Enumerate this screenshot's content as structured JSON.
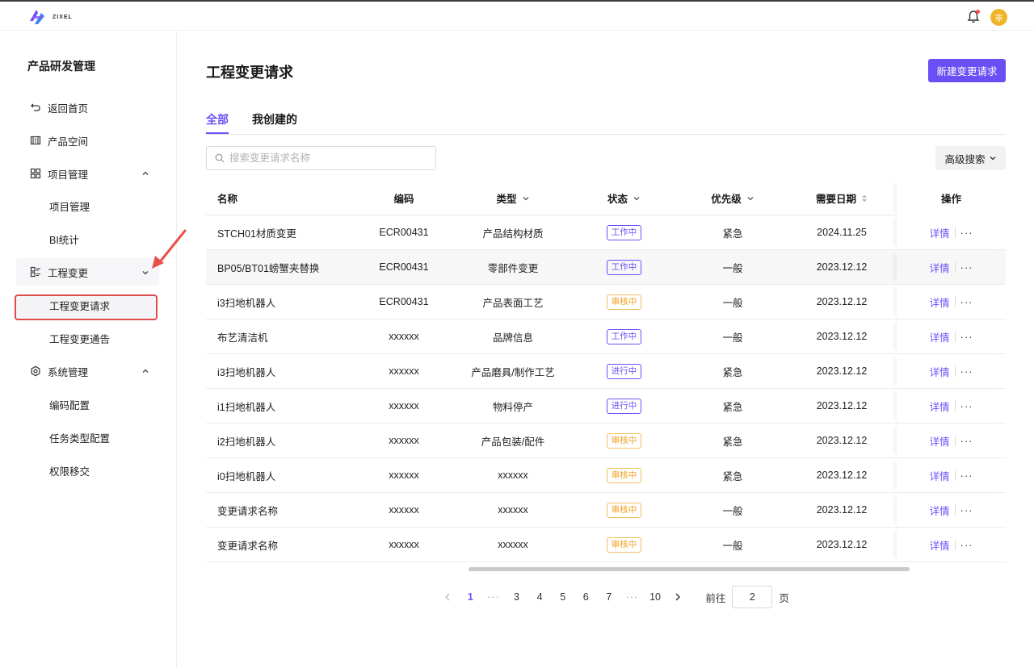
{
  "app": {
    "logo_text": "ZIXEL",
    "avatar_text": "非"
  },
  "sidebar": {
    "title": "产品研发管理",
    "items": [
      {
        "label": "返回首页",
        "icon": "back-arrow-icon"
      },
      {
        "label": "产品空间",
        "icon": "product-space-icon"
      },
      {
        "label": "项目管理",
        "icon": "grid-icon",
        "expanded": true,
        "children": [
          "项目管理",
          "BI统计"
        ]
      },
      {
        "label": "工程变更",
        "icon": "list-icon",
        "expanded": true,
        "children": [
          "工程变更请求",
          "工程变更通告"
        ]
      },
      {
        "label": "系统管理",
        "icon": "gear-icon",
        "expanded": true,
        "children": [
          "编码配置",
          "任务类型配置",
          "权限移交"
        ]
      }
    ],
    "selected": "工程变更请求"
  },
  "main": {
    "title": "工程变更请求",
    "new_button": "新建变更请求",
    "tabs": [
      "全部",
      "我创建的"
    ],
    "active_tab": "全部",
    "search_placeholder": "搜索变更请求名称",
    "advanced_search": "高级搜索"
  },
  "table": {
    "columns": [
      "名称",
      "编码",
      "类型",
      "状态",
      "优先级",
      "需要日期",
      "操作"
    ],
    "rows": [
      {
        "name": "STCH01材质变更",
        "code": "ECR00431",
        "type": "产品结构材质",
        "status": "工作中",
        "status_kind": "work",
        "priority": "紧急",
        "date": "2024.11.25",
        "action": "详情"
      },
      {
        "name": "BP05/BT01螃蟹夹替换",
        "code": "ECR00431",
        "type": "零部件变更",
        "status": "工作中",
        "status_kind": "work",
        "priority": "一般",
        "date": "2023.12.12",
        "action": "详情"
      },
      {
        "name": "i3扫地机器人",
        "code": "ECR00431",
        "type": "产品表面工艺",
        "status": "审核中",
        "status_kind": "review",
        "priority": "一般",
        "date": "2023.12.12",
        "action": "详情"
      },
      {
        "name": "布艺清洁机",
        "code": "xxxxxx",
        "type": "品牌信息",
        "status": "工作中",
        "status_kind": "work",
        "priority": "一般",
        "date": "2023.12.12",
        "action": "详情"
      },
      {
        "name": "i3扫地机器人",
        "code": "xxxxxx",
        "type": "产品磨具/制作工艺",
        "status": "进行中",
        "status_kind": "work",
        "priority": "紧急",
        "date": "2023.12.12",
        "action": "详情"
      },
      {
        "name": "i1扫地机器人",
        "code": "xxxxxx",
        "type": "物料停产",
        "status": "进行中",
        "status_kind": "work",
        "priority": "紧急",
        "date": "2023.12.12",
        "action": "详情"
      },
      {
        "name": "i2扫地机器人",
        "code": "xxxxxx",
        "type": "产品包装/配件",
        "status": "审核中",
        "status_kind": "review",
        "priority": "紧急",
        "date": "2023.12.12",
        "action": "详情"
      },
      {
        "name": "i0扫地机器人",
        "code": "xxxxxx",
        "type": "xxxxxx",
        "status": "审核中",
        "status_kind": "review",
        "priority": "紧急",
        "date": "2023.12.12",
        "action": "详情"
      },
      {
        "name": "变更请求名称",
        "code": "xxxxxx",
        "type": "xxxxxx",
        "status": "审核中",
        "status_kind": "review",
        "priority": "一般",
        "date": "2023.12.12",
        "action": "详情"
      },
      {
        "name": "变更请求名称",
        "code": "xxxxxx",
        "type": "xxxxxx",
        "status": "审核中",
        "status_kind": "review",
        "priority": "一般",
        "date": "2023.12.12",
        "action": "详情"
      }
    ]
  },
  "pagination": {
    "pages": [
      "1",
      "···",
      "3",
      "4",
      "5",
      "6",
      "7",
      "···",
      "10"
    ],
    "current": "1",
    "goto_label": "前往",
    "goto_value": "2",
    "goto_unit": "页"
  },
  "colors": {
    "accent": "#6b4ff6",
    "review": "#f0a020",
    "highlight_border": "#e04b4b"
  }
}
